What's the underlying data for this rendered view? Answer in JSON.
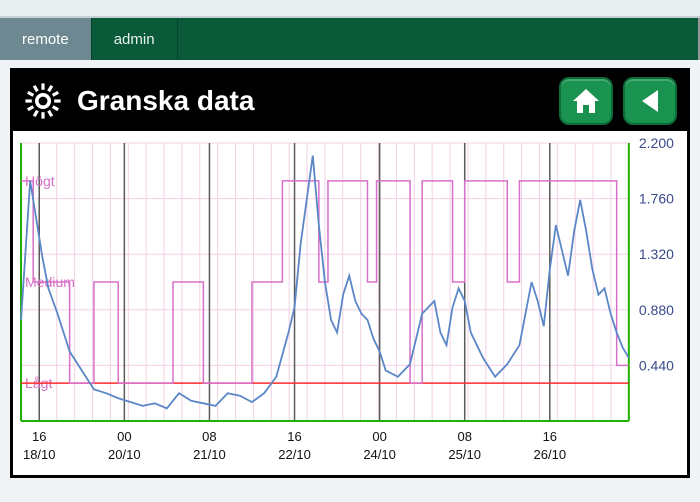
{
  "tabs": [
    {
      "label": "remote",
      "active": true
    },
    {
      "label": "admin",
      "active": false
    }
  ],
  "header": {
    "title": "Granska data"
  },
  "chart_data": {
    "type": "line",
    "ylim": [
      0,
      2.2
    ],
    "y_ticks": [
      0.44,
      0.88,
      1.32,
      1.76,
      2.2
    ],
    "y_tick_labels": [
      "0.440",
      "0.880",
      "1.320",
      "1.760",
      "2.200"
    ],
    "x_tick_labels_top": [
      "16",
      "00",
      "08",
      "16",
      "00",
      "08",
      "16"
    ],
    "x_tick_labels_bot": [
      "18/10",
      "20/10",
      "21/10",
      "22/10",
      "24/10",
      "25/10",
      "26/10"
    ],
    "level_labels": {
      "high": "Högt",
      "medium": "Medium",
      "low": "Lågt"
    },
    "level_values": {
      "high": 1.9,
      "medium": 1.1,
      "low": 0.3
    },
    "series": [
      {
        "name": "threshold-red",
        "color": "#ff2a2a",
        "values": [
          [
            0,
            0.3
          ],
          [
            1,
            0.3
          ]
        ]
      },
      {
        "name": "mode-purple-step",
        "color": "#d770c9",
        "values": [
          [
            0.0,
            1.9
          ],
          [
            0.02,
            1.9
          ],
          [
            0.02,
            1.1
          ],
          [
            0.08,
            1.1
          ],
          [
            0.08,
            0.3
          ],
          [
            0.12,
            0.3
          ],
          [
            0.12,
            1.1
          ],
          [
            0.16,
            1.1
          ],
          [
            0.16,
            0.3
          ],
          [
            0.25,
            0.3
          ],
          [
            0.25,
            1.1
          ],
          [
            0.3,
            1.1
          ],
          [
            0.3,
            0.3
          ],
          [
            0.38,
            0.3
          ],
          [
            0.38,
            1.1
          ],
          [
            0.43,
            1.1
          ],
          [
            0.43,
            1.9
          ],
          [
            0.49,
            1.9
          ],
          [
            0.49,
            1.1
          ],
          [
            0.505,
            1.1
          ],
          [
            0.505,
            1.9
          ],
          [
            0.57,
            1.9
          ],
          [
            0.57,
            1.1
          ],
          [
            0.585,
            1.1
          ],
          [
            0.585,
            1.9
          ],
          [
            0.64,
            1.9
          ],
          [
            0.64,
            0.3
          ],
          [
            0.66,
            0.3
          ],
          [
            0.66,
            1.9
          ],
          [
            0.71,
            1.9
          ],
          [
            0.71,
            1.1
          ],
          [
            0.73,
            1.1
          ],
          [
            0.73,
            1.9
          ],
          [
            0.8,
            1.9
          ],
          [
            0.8,
            1.1
          ],
          [
            0.82,
            1.1
          ],
          [
            0.82,
            1.9
          ],
          [
            0.98,
            1.9
          ],
          [
            0.98,
            0.44
          ],
          [
            1.0,
            0.44
          ]
        ]
      },
      {
        "name": "data-blue",
        "color": "#5b87c7",
        "values": [
          [
            0.0,
            0.8
          ],
          [
            0.015,
            1.9
          ],
          [
            0.025,
            1.6
          ],
          [
            0.035,
            1.3
          ],
          [
            0.045,
            1.05
          ],
          [
            0.06,
            0.85
          ],
          [
            0.08,
            0.55
          ],
          [
            0.1,
            0.4
          ],
          [
            0.12,
            0.25
          ],
          [
            0.14,
            0.22
          ],
          [
            0.16,
            0.18
          ],
          [
            0.18,
            0.15
          ],
          [
            0.2,
            0.12
          ],
          [
            0.22,
            0.14
          ],
          [
            0.24,
            0.1
          ],
          [
            0.26,
            0.22
          ],
          [
            0.28,
            0.16
          ],
          [
            0.3,
            0.14
          ],
          [
            0.32,
            0.12
          ],
          [
            0.34,
            0.22
          ],
          [
            0.36,
            0.2
          ],
          [
            0.38,
            0.15
          ],
          [
            0.4,
            0.22
          ],
          [
            0.42,
            0.35
          ],
          [
            0.44,
            0.7
          ],
          [
            0.45,
            0.9
          ],
          [
            0.46,
            1.4
          ],
          [
            0.47,
            1.75
          ],
          [
            0.48,
            2.1
          ],
          [
            0.49,
            1.55
          ],
          [
            0.5,
            1.1
          ],
          [
            0.51,
            0.8
          ],
          [
            0.52,
            0.7
          ],
          [
            0.53,
            1.0
          ],
          [
            0.54,
            1.15
          ],
          [
            0.55,
            0.95
          ],
          [
            0.56,
            0.85
          ],
          [
            0.57,
            0.8
          ],
          [
            0.58,
            0.65
          ],
          [
            0.59,
            0.55
          ],
          [
            0.6,
            0.4
          ],
          [
            0.62,
            0.35
          ],
          [
            0.64,
            0.45
          ],
          [
            0.66,
            0.85
          ],
          [
            0.68,
            0.95
          ],
          [
            0.69,
            0.7
          ],
          [
            0.7,
            0.6
          ],
          [
            0.71,
            0.9
          ],
          [
            0.72,
            1.05
          ],
          [
            0.73,
            0.95
          ],
          [
            0.74,
            0.7
          ],
          [
            0.76,
            0.5
          ],
          [
            0.78,
            0.35
          ],
          [
            0.8,
            0.45
          ],
          [
            0.82,
            0.6
          ],
          [
            0.83,
            0.85
          ],
          [
            0.84,
            1.1
          ],
          [
            0.85,
            0.95
          ],
          [
            0.86,
            0.75
          ],
          [
            0.87,
            1.2
          ],
          [
            0.88,
            1.55
          ],
          [
            0.89,
            1.35
          ],
          [
            0.9,
            1.15
          ],
          [
            0.91,
            1.5
          ],
          [
            0.92,
            1.75
          ],
          [
            0.93,
            1.5
          ],
          [
            0.94,
            1.2
          ],
          [
            0.95,
            1.0
          ],
          [
            0.96,
            1.05
          ],
          [
            0.97,
            0.85
          ],
          [
            0.98,
            0.7
          ],
          [
            0.99,
            0.58
          ],
          [
            1.0,
            0.5
          ]
        ]
      }
    ]
  }
}
